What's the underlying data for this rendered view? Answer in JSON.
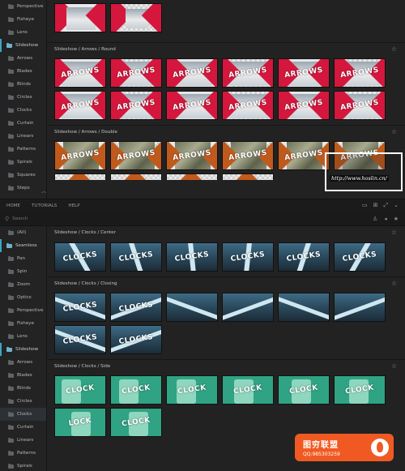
{
  "sidebar_top": {
    "items": [
      {
        "label": "Perspective",
        "kind": "sub"
      },
      {
        "label": "Fisheye",
        "kind": "sub"
      },
      {
        "label": "Lens",
        "kind": "sub"
      },
      {
        "label": "Slideshow",
        "kind": "group"
      },
      {
        "label": "Arrows",
        "kind": "sub"
      },
      {
        "label": "Blades",
        "kind": "sub"
      },
      {
        "label": "Blinds",
        "kind": "sub"
      },
      {
        "label": "Circles",
        "kind": "sub"
      },
      {
        "label": "Clocks",
        "kind": "sub"
      },
      {
        "label": "Curtain",
        "kind": "sub"
      },
      {
        "label": "Linears",
        "kind": "sub"
      },
      {
        "label": "Patterns",
        "kind": "sub"
      },
      {
        "label": "Spirals",
        "kind": "sub"
      },
      {
        "label": "Squares",
        "kind": "sub"
      },
      {
        "label": "Steps",
        "kind": "sub"
      },
      {
        "label": "Various",
        "kind": "sub"
      }
    ]
  },
  "sidebar_bottom": {
    "items": [
      {
        "label": "(All)",
        "kind": "sub"
      },
      {
        "label": "Seamless",
        "kind": "group"
      },
      {
        "label": "Pan",
        "kind": "sub"
      },
      {
        "label": "Spin",
        "kind": "sub"
      },
      {
        "label": "Zoom",
        "kind": "sub"
      },
      {
        "label": "Optics",
        "kind": "sub"
      },
      {
        "label": "Perspective",
        "kind": "sub"
      },
      {
        "label": "Fisheye",
        "kind": "sub"
      },
      {
        "label": "Lens",
        "kind": "sub"
      },
      {
        "label": "Slideshow",
        "kind": "group"
      },
      {
        "label": "Arrows",
        "kind": "sub"
      },
      {
        "label": "Blades",
        "kind": "sub"
      },
      {
        "label": "Blinds",
        "kind": "sub"
      },
      {
        "label": "Circles",
        "kind": "sub"
      },
      {
        "label": "Clocks",
        "kind": "sub",
        "selected": true
      },
      {
        "label": "Curtain",
        "kind": "sub"
      },
      {
        "label": "Linears",
        "kind": "sub"
      },
      {
        "label": "Patterns",
        "kind": "sub"
      },
      {
        "label": "Spirals",
        "kind": "sub"
      }
    ]
  },
  "sections_top": {
    "round": {
      "title": "Slideshow / Arrows / Round",
      "thumb_text": [
        "ARROWS",
        "ARROWS",
        "ARROWS",
        "ARROWS",
        "ARROWS",
        "ARROWS",
        "ARROWS",
        "ARROWS",
        "ARROWS",
        "ARROWS",
        "ARROWS",
        "ARROWS"
      ]
    },
    "double": {
      "title": "Slideshow / Arrows / Double",
      "thumb_text": [
        "ARROWS",
        "ARROWS",
        "ARROWS",
        "ARROWS",
        "ARROWS",
        "ARROWS"
      ]
    }
  },
  "toolbar": {
    "home": "HOME",
    "tutorials": "TUTORIALS",
    "help": "HELP"
  },
  "search": {
    "placeholder": "Search"
  },
  "sections_bottom": {
    "center": {
      "title": "Slideshow / Clocks / Center",
      "thumb_text": [
        "CLOCKS",
        "CLOCKS",
        "CLOCKS",
        "CLOCKS",
        "CLOCKS",
        "CLOCKS"
      ]
    },
    "closing": {
      "title": "Slideshow / Clocks / Closing",
      "thumb_text": [
        "CLOCKS",
        "CLOCKS",
        "",
        "",
        "",
        "",
        "CLOCKS",
        "CLOCKS"
      ]
    },
    "side": {
      "title": "Slideshow / Clocks / Side",
      "thumb_text": [
        "CLOCK",
        "CLOCK",
        "CLOCK",
        "CLOCK",
        "CLOCK",
        "CLOCK",
        "LOCK",
        "CLOCK"
      ]
    }
  },
  "watermark": {
    "url": "http://www.hoslin.cn/"
  },
  "badge": {
    "title": "图穷联盟",
    "qq": "QQ:985303259"
  },
  "colors": {
    "accent": "#3aa6c6",
    "red": "#d5173d",
    "orange": "#c05a1c",
    "teal": "#2fa383",
    "badge": "#f05a22"
  }
}
